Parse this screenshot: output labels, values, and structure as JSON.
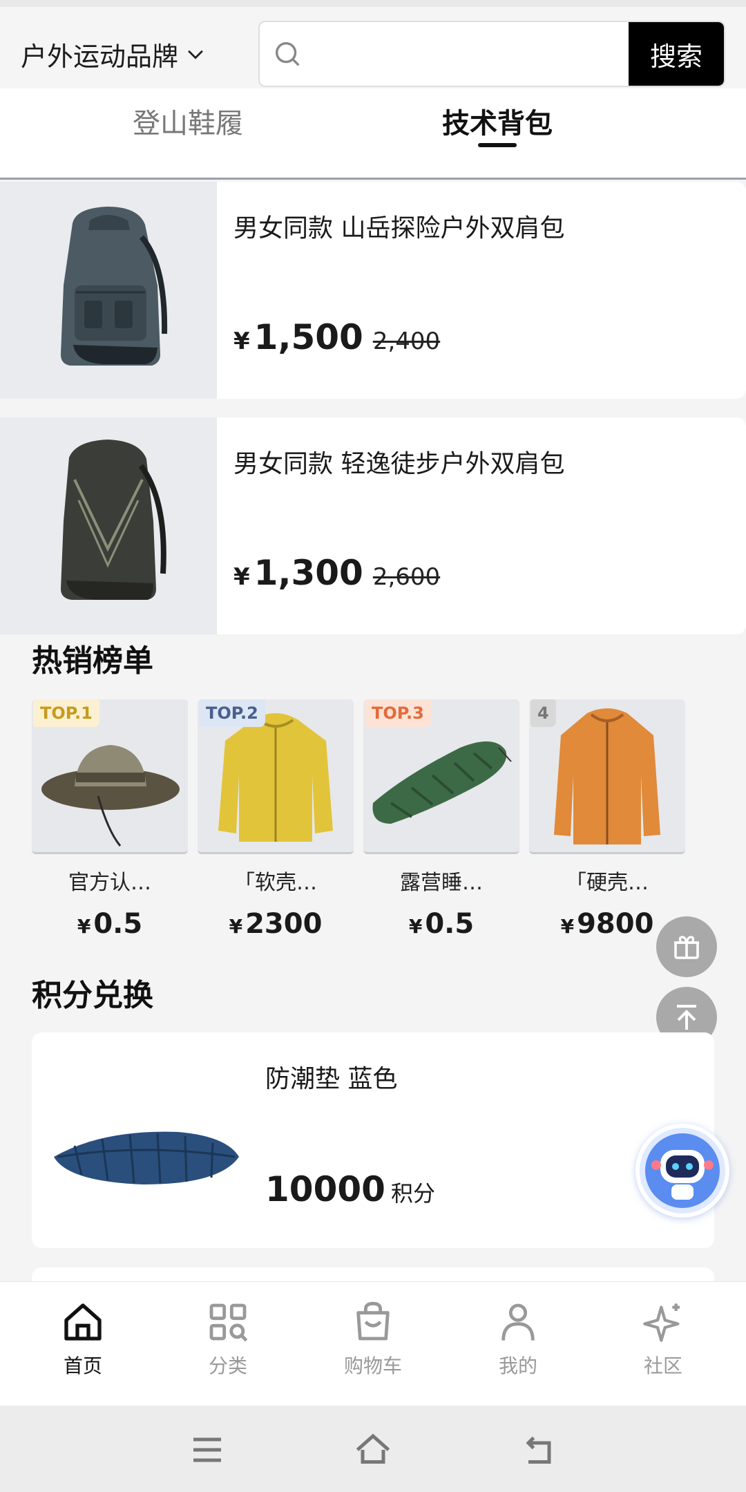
{
  "header": {
    "brand_selector": "户外运动品牌",
    "search_value": "",
    "search_button": "搜索"
  },
  "tabs": [
    {
      "label": "登山鞋履",
      "active": false
    },
    {
      "label": "技术背包",
      "active": true
    }
  ],
  "products": [
    {
      "title": "男女同款 山岳探险户外双肩包",
      "currency": "¥",
      "price": "1,500",
      "original_price": "2,400",
      "image": "backpack-gray-icon"
    },
    {
      "title": "男女同款 轻逸徒步户外双肩包",
      "currency": "¥",
      "price": "1,300",
      "original_price": "2,600",
      "image": "backpack-dark-icon"
    }
  ],
  "hot_list": {
    "title": "热销榜单",
    "items": [
      {
        "rank": "TOP.1",
        "name": "官方认…",
        "currency": "¥",
        "price": "0.5",
        "image": "bucket-hat-icon"
      },
      {
        "rank": "TOP.2",
        "name": "「软壳…",
        "currency": "¥",
        "price": "2300",
        "image": "yellow-jacket-icon"
      },
      {
        "rank": "TOP.3",
        "name": "露营睡…",
        "currency": "¥",
        "price": "0.5",
        "image": "sleeping-bag-icon"
      },
      {
        "rank": "4",
        "name": "「硬壳…",
        "currency": "¥",
        "price": "9800",
        "image": "orange-jacket-icon"
      }
    ]
  },
  "points": {
    "title": "积分兑换",
    "item": {
      "name": "防潮垫 蓝色",
      "points": "10000",
      "unit": "积分",
      "image": "sleeping-pad-icon"
    }
  },
  "floating": [
    "gift-icon",
    "back-to-top-icon",
    "robot-assistant-icon"
  ],
  "bottom_nav": [
    {
      "label": "首页",
      "icon": "home-icon",
      "active": true
    },
    {
      "label": "分类",
      "icon": "category-icon",
      "active": false
    },
    {
      "label": "购物车",
      "icon": "cart-icon",
      "active": false
    },
    {
      "label": "我的",
      "icon": "user-icon",
      "active": false
    },
    {
      "label": "社区",
      "icon": "sparkle-icon",
      "active": false
    }
  ],
  "colors": {
    "accent": "#000000",
    "rank1_bg": "#fbf1d2",
    "rank1_text": "#c79a1e",
    "rank2_bg": "#dde6f4",
    "rank2_text": "#4a5f8c",
    "rank3_bg": "#fde3d6",
    "rank3_text": "#e36b3a",
    "rank4_bg": "#d8d8d8",
    "rank4_text": "#777777"
  }
}
